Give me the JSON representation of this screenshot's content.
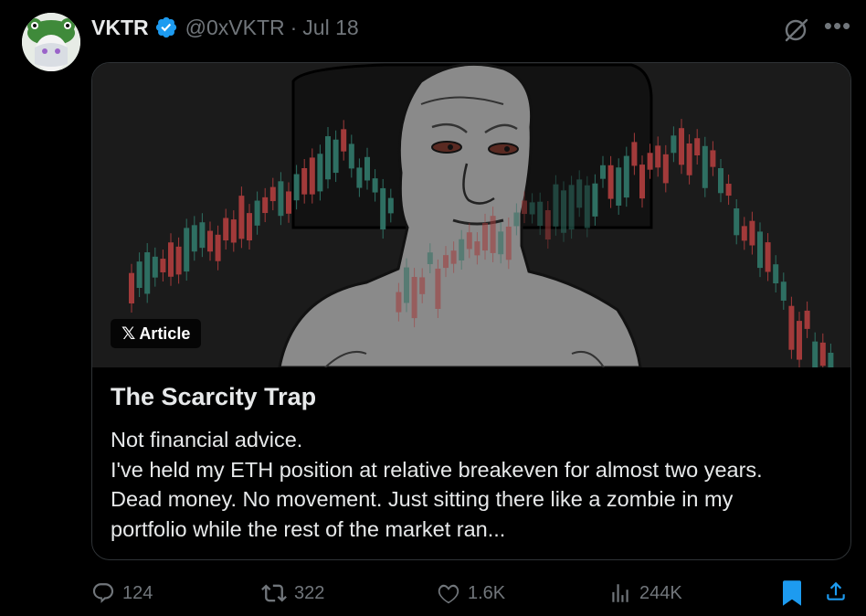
{
  "post": {
    "author_name": "VKTR",
    "handle": "@0xVKTR",
    "separator": "·",
    "date": "Jul 18",
    "more_glyph": "•••"
  },
  "article": {
    "badge_label": "Article",
    "badge_glyph": "𝕏",
    "title": "The Scarcity Trap",
    "body_lines": [
      "Not financial advice.",
      "I've held my ETH position at relative breakeven for almost two years.",
      "Dead money. No movement. Just sitting there like a zombie in my",
      "portfolio while the rest of the market ran..."
    ]
  },
  "actions": {
    "replies": "124",
    "reposts": "322",
    "likes": "1.6K",
    "views": "244K"
  },
  "icons": [
    "avatar",
    "verified-badge-icon",
    "grok-icon",
    "more-icon",
    "reply-icon",
    "repost-icon",
    "like-icon",
    "views-icon",
    "bookmark-icon",
    "share-icon"
  ],
  "colors": {
    "background": "#000000",
    "text": "#e7e9ea",
    "muted": "#71767b",
    "verified": "#1d9bf0",
    "bookmark_active": "#1d9bf0",
    "candle_up": "#2e6f62",
    "candle_down": "#a23a3a"
  }
}
